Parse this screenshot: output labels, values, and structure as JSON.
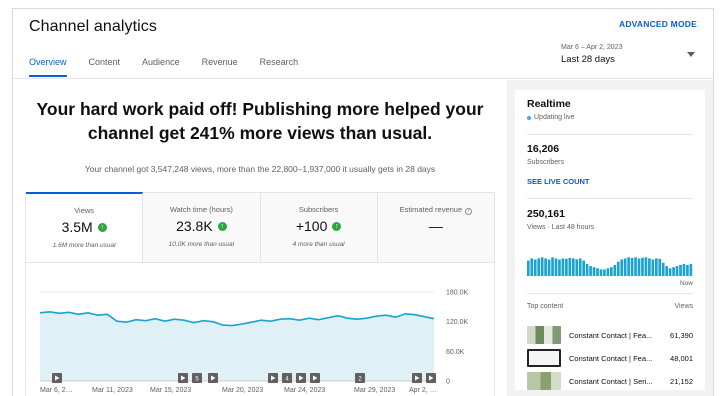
{
  "header": {
    "title": "Channel analytics",
    "advanced_mode": "ADVANCED MODE",
    "tabs": [
      "Overview",
      "Content",
      "Audience",
      "Revenue",
      "Research"
    ],
    "date_range": {
      "sub": "Mar 6 – Apr 2, 2023",
      "main": "Last 28 days"
    }
  },
  "summary": {
    "headline": "Your hard work paid off! Publishing more helped your channel get 241% more views than usual.",
    "subline": "Your channel got 3,547,248 views, more than the 22,800–1,937,000 it usually gets in 28 days"
  },
  "cards": [
    {
      "label": "Views",
      "value": "3.5M",
      "note": "1.6M more than usual",
      "trend": "up"
    },
    {
      "label": "Watch time (hours)",
      "value": "23.8K",
      "note": "10.0K more than usual",
      "trend": "up"
    },
    {
      "label": "Subscribers",
      "value": "+100",
      "note": "4 more than usual",
      "trend": "up"
    },
    {
      "label": "Estimated revenue",
      "value": "—",
      "note": "",
      "trend": "none"
    }
  ],
  "chart_data": {
    "type": "area",
    "x_labels": [
      "Mar 6, 2…",
      "Mar 11, 2023",
      "Mar 15, 2023",
      "Mar 20, 2023",
      "Mar 24, 2023",
      "Mar 29, 2023",
      "Apr 2, …"
    ],
    "y_ticks": [
      "180.0K",
      "120.0K",
      "60.0K",
      "0"
    ],
    "ylim": [
      0,
      180000
    ],
    "values": [
      138000,
      140000,
      137000,
      139000,
      135000,
      138000,
      133000,
      135000,
      121000,
      119000,
      124000,
      122000,
      126000,
      121000,
      125000,
      123000,
      118000,
      122000,
      120000,
      113000,
      112000,
      115000,
      119000,
      123000,
      121000,
      125000,
      126000,
      123000,
      127000,
      124000,
      128000,
      132000,
      127000,
      125000,
      127000,
      131000,
      133000,
      129000,
      136000,
      134000,
      130000,
      126000
    ],
    "markers": [
      "",
      "",
      "5",
      "",
      "",
      "4",
      "",
      "",
      "2",
      "",
      ""
    ],
    "color": "#1aa2d2"
  },
  "realtime": {
    "title": "Realtime",
    "status": "Updating live",
    "subscribers_value": "16,206",
    "subscribers_label": "Subscribers",
    "see_live": "SEE LIVE COUNT",
    "views_value": "250,161",
    "views_label": "Views · Last 48 hours",
    "now": "Now",
    "bars": [
      0.7,
      0.8,
      0.75,
      0.8,
      0.85,
      0.8,
      0.75,
      0.85,
      0.8,
      0.75,
      0.8,
      0.78,
      0.82,
      0.8,
      0.76,
      0.8,
      0.7,
      0.55,
      0.45,
      0.4,
      0.35,
      0.3,
      0.3,
      0.35,
      0.4,
      0.5,
      0.65,
      0.75,
      0.8,
      0.85,
      0.82,
      0.85,
      0.8,
      0.83,
      0.85,
      0.8,
      0.75,
      0.8,
      0.78,
      0.6,
      0.45,
      0.35,
      0.4,
      0.45,
      0.5,
      0.55,
      0.5,
      0.55
    ],
    "top_content_label": "Top content",
    "views_col": "Views",
    "top_content": [
      {
        "title": "Constant Contact | Fea...",
        "views": "61,390"
      },
      {
        "title": "Constant Contact | Fea...",
        "views": "48,001"
      },
      {
        "title": "Constant Contact | Seri...",
        "views": "21,152"
      }
    ]
  }
}
